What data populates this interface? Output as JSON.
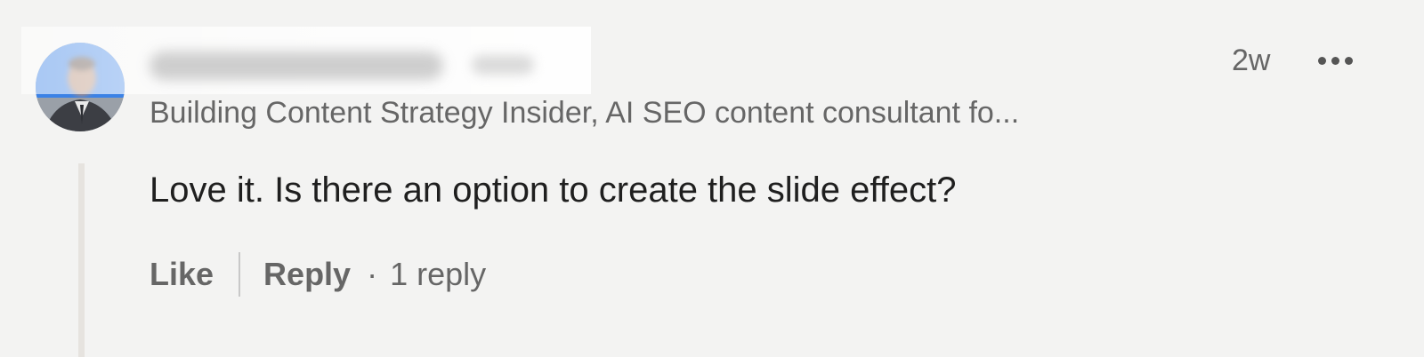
{
  "comment": {
    "author": {
      "avatar_icon": "user-avatar",
      "name_blurred": true
    },
    "headline": "Building Content Strategy Insider, AI SEO content consultant fo...",
    "timestamp": "2w",
    "more_icon": "ellipsis-icon",
    "text": "Love it. Is there an option to create the slide effect?",
    "actions": {
      "like_label": "Like",
      "reply_label": "Reply",
      "separator": "·",
      "reply_count_label": "1 reply"
    }
  },
  "colors": {
    "background": "#f3f3f2",
    "text_primary": "#1f1f1f",
    "text_secondary": "#666666",
    "thread_line": "#e6e3df",
    "avatar_ring_blue": "#2a7de1"
  }
}
